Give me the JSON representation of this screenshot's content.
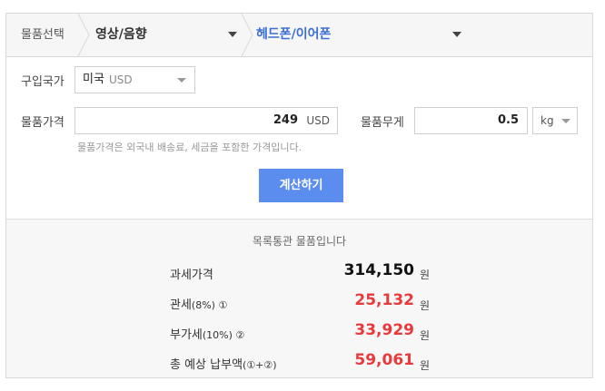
{
  "category": {
    "label": "물품선택",
    "primary": "영상/음향",
    "secondary": "헤드폰/이어폰"
  },
  "form": {
    "country_label": "구입국가",
    "country_value": "미국",
    "country_currency": "USD",
    "price_label": "물품가격",
    "price_value": "249",
    "price_currency": "USD",
    "weight_label": "물품무게",
    "weight_value": "0.5",
    "weight_unit": "kg",
    "hint": "물품가격은 외국내 배송료, 세금을 포함한 가격입니다.",
    "calc_button": "계산하기"
  },
  "result": {
    "title": "목록통관 물품입니다",
    "rows": [
      {
        "label": "과세가격",
        "note": "",
        "value": "314,150",
        "unit": "원",
        "color": "#111111"
      },
      {
        "label": "관세",
        "note": "(8%) ①",
        "value": "25,132",
        "unit": "원",
        "color": "#e8393b"
      },
      {
        "label": "부가세",
        "note": "(10%) ②",
        "value": "33,929",
        "unit": "원",
        "color": "#e8393b"
      },
      {
        "label": "총 예상 납부액",
        "note": "(①+②)",
        "value": "59,061",
        "unit": "원",
        "color": "#e8393b"
      }
    ]
  },
  "colors": {
    "accent": "#5b8def",
    "selected_category": "#3b6fd6",
    "amount_red": "#e8393b"
  }
}
